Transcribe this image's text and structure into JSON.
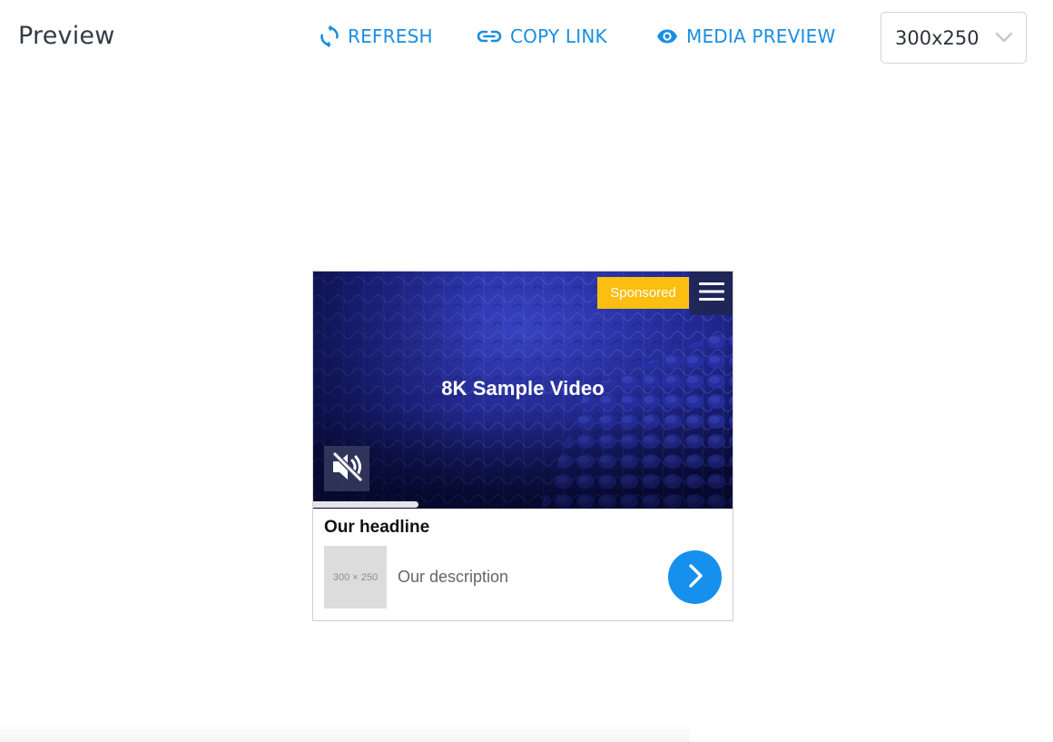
{
  "header": {
    "title": "Preview",
    "refresh_label": "REFRESH",
    "copy_link_label": "COPY LINK",
    "media_preview_label": "MEDIA PREVIEW",
    "size_select_value": "300x250"
  },
  "ad": {
    "video_title": "8K Sample Video",
    "sponsored_label": "Sponsored",
    "headline": "Our headline",
    "thumbnail_text": "300 × 250",
    "description": "Our description",
    "video_progress_fraction": 0.25
  },
  "colors": {
    "accent": "#1a8fe0",
    "sponsored": "#fbbe11",
    "cta": "#1590ec",
    "video_bg": "#1c2383"
  },
  "icons": {
    "refresh": "refresh-icon",
    "copy_link": "link-icon",
    "media_preview": "eye-icon",
    "dropdown": "chevron-down-icon",
    "menu": "hamburger-menu-icon",
    "mute": "volume-muted-icon",
    "cta": "chevron-right-icon"
  }
}
